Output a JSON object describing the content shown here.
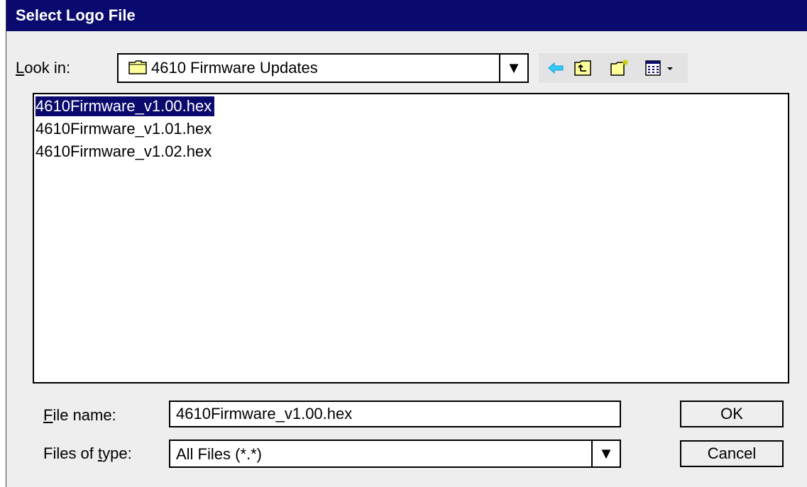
{
  "dialog": {
    "title": "Select Logo File"
  },
  "look_in": {
    "label_accel": "L",
    "label_rest": "ook in:",
    "value": "4610 Firmware Updates",
    "dropdown_arrow": "▼"
  },
  "toolbar": {
    "icons": [
      "back-arrow-icon",
      "up-folder-icon",
      "new-folder-icon",
      "view-menu-icon"
    ]
  },
  "files": {
    "items": [
      {
        "name": "4610Firmware_v1.00.hex",
        "selected": true
      },
      {
        "name": "4610Firmware_v1.01.hex",
        "selected": false
      },
      {
        "name": "4610Firmware_v1.02.hex",
        "selected": false
      }
    ]
  },
  "file_name": {
    "label_accel": "F",
    "label_rest": "ile name:",
    "value": "4610Firmware_v1.00.hex"
  },
  "file_type": {
    "label_before": "Files of ",
    "label_accel": "t",
    "label_after": "ype:",
    "value": "All Files (*.*)",
    "dropdown_arrow": "▼"
  },
  "buttons": {
    "ok": "OK",
    "cancel": "Cancel"
  },
  "colors": {
    "titlebar": "#0a0a6e",
    "selection": "#0a0a6e",
    "folder": "#ffff99"
  }
}
